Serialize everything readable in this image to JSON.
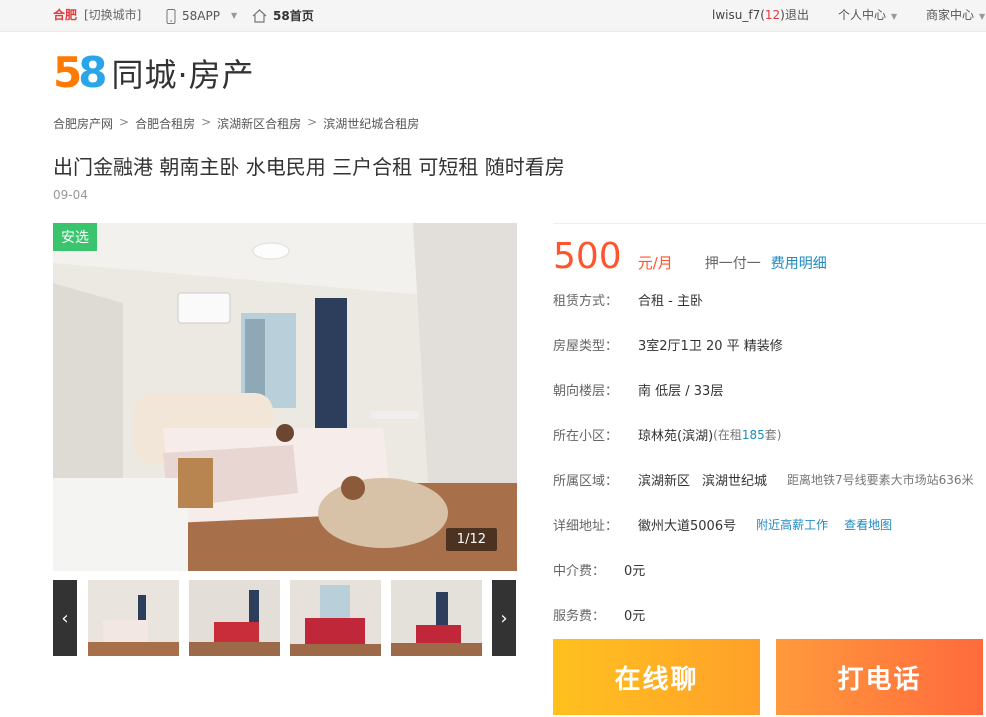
{
  "topbar": {
    "city": "合肥",
    "switch_city": "[切换城市]",
    "app": "58APP",
    "home": "58首页",
    "username": "lwisu_f7",
    "msg_count_open": "(",
    "msg_count": "12",
    "msg_count_close": ")",
    "logout": "退出",
    "personal_center": "个人中心",
    "merchant_center": "商家中心"
  },
  "logo": {
    "num_5": "5",
    "num_8": "8",
    "text": "同城·房产"
  },
  "breadcrumb": [
    "合肥房产网",
    "合肥合租房",
    "滨湖新区合租房",
    "滨湖世纪城合租房"
  ],
  "breadcrumb_sep": ">",
  "listing": {
    "title": "出门金融港 朝南主卧 水电民用 三户合租 可短租 随时看房",
    "date": "09-04"
  },
  "gallery": {
    "tag": "安选",
    "counter": "1/12",
    "prev": "‹",
    "next": "›"
  },
  "price": {
    "amount": "500",
    "unit": "元/月",
    "payment": "押一付一",
    "fee_link": "费用明细"
  },
  "details": {
    "rent_type": {
      "label": "租赁方式：",
      "value": "合租 - 主卧"
    },
    "house_type": {
      "label": "房屋类型：",
      "value": "3室2厅1卫  20 平  精装修"
    },
    "orientation": {
      "label": "朝向楼层：",
      "value": "南  低层 / 33层"
    },
    "community": {
      "label": "所在小区：",
      "value": "琼林苑(滨湖)",
      "count_prefix": "(在租 ",
      "count": "185",
      "count_suffix": " 套)"
    },
    "area": {
      "label": "所属区域：",
      "district": "滨湖新区",
      "sub": "滨湖世纪城",
      "distance": "距离地铁7号线要素大市场站636米"
    },
    "address": {
      "label": "详细地址：",
      "value": "徽州大道5006号",
      "jobs_link": "附近高薪工作",
      "map_link": "查看地图"
    },
    "agent_fee": {
      "label": "中介费：",
      "value": "0元"
    },
    "service_fee": {
      "label": "服务费：",
      "value": "0元"
    }
  },
  "actions": {
    "chat": "在线聊",
    "call": "打电话"
  },
  "colors": {
    "accent": "#ff552e",
    "link": "#1e8bc3",
    "tag": "#3bc46e"
  }
}
